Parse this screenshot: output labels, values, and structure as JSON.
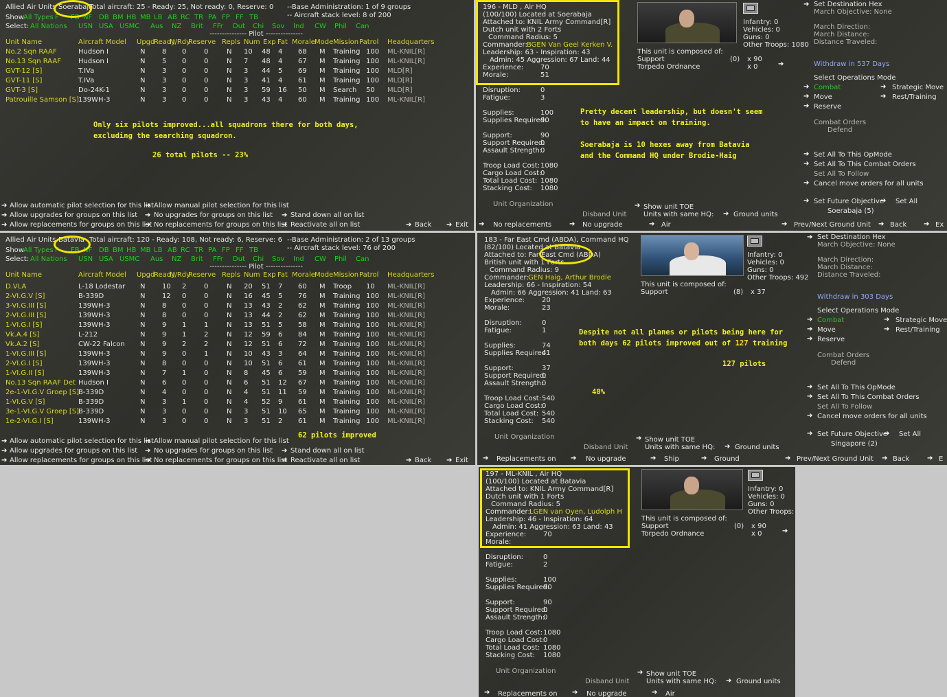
{
  "soerabaja_air": {
    "title_prefix": "Allied Air Units",
    "base": "Soerabaja",
    "summary": "Total aircraft: 25 - Ready: 25, Not ready: 0, Reserve: 0",
    "base_admin": "--Base Administration: 1 of 9 groups",
    "stack": "-- Aircraft stack level: 8 of 200",
    "show_label": "Show",
    "show_items": [
      "All Types",
      "F",
      "FB",
      "NF",
      "DB",
      "BM",
      "HB",
      "MB",
      "LB",
      "AB",
      "RC",
      "TR",
      "PA",
      "FP",
      "FF",
      "TB"
    ],
    "select_label": "Select:",
    "select_items": [
      "All Nations",
      "USN",
      "USA",
      "USMC",
      "Aus",
      "NZ",
      "Brit",
      "FFr",
      "Dut",
      "Chi",
      "Sov",
      "Ind",
      "CW",
      "Phil",
      "Can"
    ],
    "pilot_header": "--------------- Pilot ---------------",
    "columns": [
      "Unit Name",
      "Aircraft Model",
      "Upgd",
      "Ready",
      "N/Rdy",
      "Reserve",
      "Repls",
      "Num",
      "Exp",
      "Fat",
      "Morale",
      "Mode",
      "Mission",
      "Patrol",
      "Headquarters"
    ],
    "rows": [
      [
        "No.2 Sqn RAAF",
        "Hudson I",
        "N",
        "8",
        "0",
        "0",
        "N",
        "10",
        "48",
        "4",
        "68",
        "M",
        "Training",
        "100",
        "ML-KNIL[R]"
      ],
      [
        "No.13 Sqn RAAF",
        "Hudson I",
        "N",
        "5",
        "0",
        "0",
        "N",
        "7",
        "48",
        "4",
        "67",
        "M",
        "Training",
        "100",
        "ML-KNIL[R]"
      ],
      [
        "GVT-12 [S]",
        "T.IVa",
        "N",
        "3",
        "0",
        "0",
        "N",
        "3",
        "44",
        "5",
        "69",
        "M",
        "Training",
        "100",
        "MLD[R]"
      ],
      [
        "GVT-11 [S]",
        "T.IVa",
        "N",
        "3",
        "0",
        "0",
        "N",
        "3",
        "41",
        "4",
        "61",
        "M",
        "Training",
        "100",
        "MLD[R]"
      ],
      [
        "GVT-3 [S]",
        "Do-24K-1",
        "N",
        "3",
        "0",
        "0",
        "N",
        "3",
        "59",
        "16",
        "50",
        "M",
        "Search",
        "50",
        "MLD[R]"
      ],
      [
        "Patrouille Samson [S]",
        "139WH-3",
        "N",
        "3",
        "0",
        "0",
        "N",
        "3",
        "43",
        "4",
        "60",
        "M",
        "Training",
        "100",
        "ML-KNIL[R]"
      ]
    ],
    "annotation1": "Only six pilots improved...all squadrons there for both days,",
    "annotation2": "excluding the searching squadron.",
    "annotation3": "26 total pilots -- 23%",
    "footer": {
      "auto_pilot": "Allow automatic pilot selection for this list",
      "manual_pilot": "Allow manual pilot selection for this list",
      "allow_upg": "Allow upgrades for groups on this list",
      "no_upg": "No upgrades for groups on this list",
      "standdown": "Stand down all on list",
      "allow_repl": "Allow replacements for groups on this list",
      "no_repl": "No replacements for groups on this list",
      "reactivate": "Reactivate all on list",
      "back": "Back",
      "exit": "Exit"
    }
  },
  "mld_hq": {
    "line1": "196 - MLD , Air HQ",
    "line2": "(100/100) Located at Soerabaja",
    "line3": "Attached to: KNIL Army Command[R]",
    "line4": "Dutch unit with 2 Forts",
    "line5": "Command Radius: 5",
    "commander_label": "Commander:",
    "commander": "BGEN Van Geel Kerken V.",
    "leadership": "Leadership: 63 - Inspiration: 43",
    "admin": "Admin: 45  Aggression: 67  Land: 44",
    "experience_label": "Experience:",
    "experience": "70",
    "morale_label": "Morale:",
    "morale": "51",
    "disruption_label": "Disruption:",
    "disruption": "0",
    "fatigue_label": "Fatigue:",
    "fatigue": "3",
    "supplies_label": "Supplies:",
    "supplies": "100",
    "supplies_req_label": "Supplies Required:",
    "supplies_req": "90",
    "support_label": "Support:",
    "support": "90",
    "support_req_label": "Support Required:",
    "support_req": "0",
    "assault_label": "Assault Strength:",
    "assault": "0",
    "troop_load_label": "Troop Load Cost:",
    "troop_load": "1080",
    "cargo_load_label": "Cargo Load Cost:",
    "cargo_load": "0",
    "total_load_label": "Total Load Cost:",
    "total_load": "1080",
    "stacking_label": "Stacking Cost:",
    "stacking": "1080",
    "infantry": "Infantry: 0",
    "vehicles": "Vehicles: 0",
    "guns": "Guns: 0",
    "other": "Other Troops: 1080",
    "composed": "This unit is composed of:",
    "comp1": "Support",
    "comp1_n": "(0)",
    "comp1_x": "x 90",
    "comp2": "Torpedo Ordnance",
    "comp2_x": "x 0",
    "annotation1": "Pretty decent leadership, but doesn't seem",
    "annotation2": "to have an impact on training.",
    "annotation3": "Soerabaja is 10 hexes away from Batavia",
    "annotation4": "and the Command HQ under Brodie-Haig",
    "unit_org": "Unit Organization",
    "disband": "Disband Unit",
    "show_toe": "Show unit TOE",
    "units_same_hq": "Units with same HQ:",
    "ground_units": "Ground units",
    "no_repl": "No replacements",
    "no_upgrade": "No upgrade",
    "air": "Air",
    "set_dest": "Set Destination Hex",
    "march_obj": "March Objective: None",
    "march_dir": "March Direction:",
    "march_dist": "March Distance:",
    "dist_trav": "Distance Traveled:",
    "withdraw": "Withdraw in 537 Days",
    "select_ops": "Select Operations Mode",
    "combat": "Combat",
    "strategic": "Strategic Move",
    "move": "Move",
    "rest": "Rest/Training",
    "reserve": "Reserve",
    "combat_orders": "Combat Orders",
    "defend": "Defend",
    "set_all_opmode": "Set All To This OpMode",
    "set_all_combat": "Set All To This Combat Orders",
    "set_all_follow": "Set All To Follow",
    "cancel_move": "Cancel move orders for all units",
    "set_future": "Set Future Objective",
    "set_all": "Set All",
    "future_val": "Soerabaja (5)",
    "prev_next": "Prev/Next Ground Unit",
    "back": "Back",
    "exit": "Ex"
  },
  "batavia_air": {
    "title_prefix": "Allied Air Units",
    "base": "Batavia",
    "summary": "Total aircraft: 120 - Ready: 108, Not ready: 6, Reserve: 6",
    "base_admin": "--Base Administration: 2 of 13 groups",
    "stack": "-- Aircraft stack level: 76 of 200",
    "show_label": "Show",
    "show_items": [
      "All Types",
      "F",
      "FB",
      "NF",
      "DB",
      "BM",
      "HB",
      "MB",
      "LB",
      "AB",
      "RC",
      "TR",
      "PA",
      "FP",
      "FF",
      "TB"
    ],
    "select_label": "Select:",
    "select_items": [
      "All Nations",
      "USN",
      "USA",
      "USMC",
      "Aus",
      "NZ",
      "Brit",
      "FFr",
      "Dut",
      "Chi",
      "Sov",
      "Ind",
      "CW",
      "Phil",
      "Can"
    ],
    "pilot_header": "--------------- Pilot ---------------",
    "columns": [
      "Unit Name",
      "Aircraft Model",
      "Upgd",
      "Ready",
      "N/Rdy",
      "Reserve",
      "Repls",
      "Num",
      "Exp",
      "Fat",
      "Morale",
      "Mode",
      "Mission",
      "Patrol",
      "Headquarters"
    ],
    "rows": [
      [
        "D.VLA",
        "L-18 Lodestar",
        "N",
        "10",
        "2",
        "0",
        "N",
        "20",
        "51",
        "7",
        "60",
        "M",
        "Troop",
        "10",
        "ML-KNIL[R]"
      ],
      [
        "2-VI.G.V [S]",
        "B-339D",
        "N",
        "12",
        "0",
        "0",
        "N",
        "16",
        "45",
        "5",
        "76",
        "M",
        "Training",
        "100",
        "ML-KNIL[R]"
      ],
      [
        "3-VI.G.III [S]",
        "139WH-3",
        "N",
        "8",
        "0",
        "0",
        "N",
        "13",
        "43",
        "2",
        "62",
        "M",
        "Training",
        "100",
        "ML-KNIL[R]"
      ],
      [
        "2-VI.G.III [S]",
        "139WH-3",
        "N",
        "8",
        "0",
        "0",
        "N",
        "13",
        "44",
        "2",
        "62",
        "M",
        "Training",
        "100",
        "ML-KNIL[R]"
      ],
      [
        "1-VI.G.I [S]",
        "139WH-3",
        "N",
        "9",
        "1",
        "1",
        "N",
        "13",
        "51",
        "5",
        "58",
        "M",
        "Training",
        "100",
        "ML-KNIL[R]"
      ],
      [
        "Vk.A.4 [S]",
        "L-212",
        "N",
        "9",
        "1",
        "2",
        "N",
        "12",
        "59",
        "6",
        "84",
        "M",
        "Training",
        "100",
        "ML-KNIL[R]"
      ],
      [
        "Vk.A.2 [S]",
        "CW-22 Falcon",
        "N",
        "9",
        "2",
        "2",
        "N",
        "12",
        "51",
        "6",
        "72",
        "M",
        "Training",
        "100",
        "ML-KNIL[R]"
      ],
      [
        "1-VI.G.III [S]",
        "139WH-3",
        "N",
        "9",
        "0",
        "1",
        "N",
        "10",
        "43",
        "3",
        "64",
        "M",
        "Training",
        "100",
        "ML-KNIL[R]"
      ],
      [
        "2-VI.G.I [S]",
        "139WH-3",
        "N",
        "8",
        "0",
        "0",
        "N",
        "10",
        "51",
        "6",
        "61",
        "M",
        "Training",
        "100",
        "ML-KNIL[R]"
      ],
      [
        "1-VI.G.II [S]",
        "139WH-3",
        "N",
        "7",
        "1",
        "0",
        "N",
        "8",
        "45",
        "6",
        "59",
        "M",
        "Training",
        "100",
        "ML-KNIL[R]"
      ],
      [
        "No.13 Sqn RAAF Det",
        "Hudson I",
        "N",
        "6",
        "0",
        "0",
        "N",
        "6",
        "51",
        "12",
        "67",
        "M",
        "Training",
        "100",
        "ML-KNIL[R]"
      ],
      [
        "2e-1-VI.G.V Groep [S]",
        "B-339D",
        "N",
        "4",
        "0",
        "0",
        "N",
        "4",
        "51",
        "11",
        "59",
        "M",
        "Training",
        "100",
        "ML-KNIL[R]"
      ],
      [
        "1-VI.G.V [S]",
        "B-339D",
        "N",
        "3",
        "1",
        "0",
        "N",
        "4",
        "52",
        "9",
        "61",
        "M",
        "Training",
        "100",
        "ML-KNIL[R]"
      ],
      [
        "3e-1-VI.G.V Groep [S]",
        "B-339D",
        "N",
        "3",
        "0",
        "0",
        "N",
        "3",
        "51",
        "10",
        "65",
        "M",
        "Training",
        "100",
        "ML-KNIL[R]"
      ],
      [
        "1e-2-VI.G.I [S]",
        "139WH-3",
        "N",
        "3",
        "0",
        "0",
        "N",
        "3",
        "51",
        "2",
        "61",
        "M",
        "Training",
        "100",
        "ML-KNIL[R]"
      ]
    ],
    "annotation1": "62 pilots improved",
    "footer": {
      "auto_pilot": "Allow automatic pilot selection for this list",
      "manual_pilot": "Allow manual pilot selection for this list",
      "allow_upg": "Allow upgrades for groups on this list",
      "no_upg": "No upgrades for groups on this list",
      "standdown": "Stand down all on list",
      "allow_repl": "Allow replacements for groups on this list",
      "no_repl": "No replacements for groups on this list",
      "reactivate": "Reactivate all on list",
      "back": "Back",
      "exit": "Exit"
    }
  },
  "abda_hq": {
    "line1": "183 - Far East Cmd (ABDA), Command HQ",
    "line2": "(82/100) Located at Batavia",
    "line3": "Attached to: Far East Cmd (ABDA)",
    "line4": "British unit with 1 Forts",
    "line5": "Command Radius: 9",
    "commander_label": "Commander:",
    "commander": "GEN Haig, Arthur Brodie",
    "leadership": "Leadership: 66 - Inspiration: 54",
    "admin": "Admin: 66  Aggression: 41  Land: 63",
    "experience_label": "Experience:",
    "experience": "20",
    "morale_label": "Morale:",
    "morale": "23",
    "disruption_label": "Disruption:",
    "disruption": "0",
    "fatigue_label": "Fatigue:",
    "fatigue": "1",
    "supplies_label": "Supplies:",
    "supplies": "74",
    "supplies_req_label": "Supplies Required:",
    "supplies_req": "41",
    "support_label": "Support:",
    "support": "37",
    "support_req_label": "Support Required:",
    "support_req": "0",
    "assault_label": "Assault Strength:",
    "assault": "0",
    "troop_load_label": "Troop Load Cost:",
    "troop_load": "540",
    "cargo_load_label": "Cargo Load Cost:",
    "cargo_load": "0",
    "total_load_label": "Total Load Cost:",
    "total_load": "540",
    "stacking_label": "Stacking Cost:",
    "stacking": "540",
    "infantry": "Infantry: 0",
    "vehicles": "Vehicles: 0",
    "guns": "Guns: 0",
    "other": "Other Troops: 492",
    "composed": "This unit is composed of:",
    "comp1": "Support",
    "comp1_n": "(8)",
    "comp1_x": "x 37",
    "annotation1": "Despite not all planes or pilots being here for",
    "annotation2": "both days 62 pilots improved out of 127 training",
    "annotation2_struck": "127",
    "annotation3": "127 pilots",
    "annotation4": "48%",
    "unit_org": "Unit Organization",
    "disband": "Disband Unit",
    "show_toe": "Show unit TOE",
    "units_same_hq": "Units with same HQ:",
    "ground_units": "Ground units",
    "repl_on": "Replacements on",
    "no_upgrade": "No upgrade",
    "ship": "Ship",
    "ground": "Ground",
    "set_dest": "Set Destination Hex",
    "march_obj": "March Objective: None",
    "march_dir": "March Direction:",
    "march_dist": "March Distance:",
    "dist_trav": "Distance Traveled:",
    "withdraw": "Withdraw in 303 Days",
    "select_ops": "Select Operations Mode",
    "combat": "Combat",
    "strategic": "Strategic Move",
    "move": "Move",
    "rest": "Rest/Training",
    "reserve": "Reserve",
    "combat_orders": "Combat Orders",
    "defend": "Defend",
    "set_all_opmode": "Set All To This OpMode",
    "set_all_combat": "Set All To This Combat Orders",
    "set_all_follow": "Set All To Follow",
    "cancel_move": "Cancel move orders for all units",
    "set_future": "Set Future Objective",
    "set_all": "Set All",
    "future_val": "Singapore (2)",
    "prev_next": "Prev/Next Ground Unit",
    "back": "Back",
    "exit": "E"
  },
  "knil_hq": {
    "line1": "197 - ML-KNIL , Air HQ",
    "line2": "(100/100) Located at Batavia",
    "line3": "Attached to: KNIL Army Command[R]",
    "line4": "Dutch unit with 1 Forts",
    "line5": "Command Radius: 5",
    "commander_label": "Commander:",
    "commander": "LGEN van Oyen, Ludolph H",
    "leadership": "Leadership: 46 - Inspiration: 64",
    "admin": "Admin: 41  Aggression: 63  Land: 43",
    "experience_label": "Experience:",
    "experience": "70",
    "morale_label": "Morale:",
    "disruption_label": "Disruption:",
    "disruption": "0",
    "fatigue_label": "Fatigue:",
    "fatigue": "2",
    "supplies_label": "Supplies:",
    "supplies": "100",
    "supplies_req_label": "Supplies Required:",
    "supplies_req": "90",
    "support_label": "Support:",
    "support": "90",
    "support_req_label": "Support Required:",
    "support_req": "0",
    "assault_label": "Assault Strength:",
    "assault": "0",
    "troop_load_label": "Troop Load Cost:",
    "troop_load": "1080",
    "cargo_load_label": "Cargo Load Cost:",
    "cargo_load": "0",
    "total_load_label": "Total Load Cost:",
    "total_load": "1080",
    "stacking_label": "Stacking Cost:",
    "stacking": "1080",
    "infantry": "Infantry: 0",
    "vehicles": "Vehicles: 0",
    "guns": "Guns: 0",
    "other": "Other Troops:",
    "composed": "This unit is composed of:",
    "comp1": "Support",
    "comp1_n": "(0)",
    "comp1_x": "x 90",
    "comp2": "Torpedo Ordnance",
    "comp2_x": "x 0",
    "unit_org": "Unit Organization",
    "disband": "Disband Unit",
    "show_toe": "Show unit TOE",
    "units_same_hq": "Units with same HQ:",
    "ground_units": "Ground units",
    "repl_on": "Replacements on",
    "no_upgrade": "No upgrade",
    "air": "Air"
  }
}
